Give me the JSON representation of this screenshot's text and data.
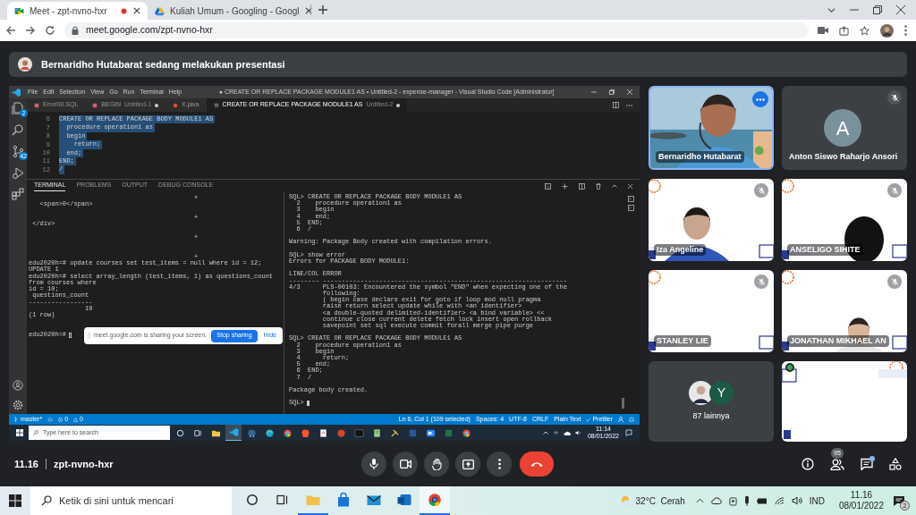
{
  "browser": {
    "tabs": [
      {
        "title": "Meet - zpt-nvno-hxr",
        "kind": "meet",
        "selected": true,
        "recording": true
      },
      {
        "title": "Kuliah Umum - Googling - Googl",
        "kind": "drive",
        "selected": false,
        "recording": false
      }
    ],
    "url": "meet.google.com/zpt-nvno-hxr"
  },
  "banner": {
    "text": "Bernaridho Hutabarat sedang melakukan presentasi"
  },
  "shared_screen": {
    "menu": [
      "File",
      "Edit",
      "Selection",
      "View",
      "Go",
      "Run",
      "Terminal",
      "Help"
    ],
    "title": "● CREATE OR REPLACE PACKAGE MODULE1 AS • Untitled-2 - expense-manager - Visual Studio Code [Administrator]",
    "activity_bar": [
      {
        "kind": "files",
        "badge": "2"
      },
      {
        "kind": "search"
      },
      {
        "kind": "source-control",
        "badge": "42"
      },
      {
        "kind": "run"
      },
      {
        "kind": "extensions"
      }
    ],
    "tabs": [
      {
        "label": "Error00.SQL",
        "kind": "sql",
        "modified": false,
        "selected": false
      },
      {
        "label": "BEGIN",
        "detail": "Untitled-1",
        "kind": "sql",
        "modified": true,
        "selected": false
      },
      {
        "label": "X.java",
        "kind": "java",
        "modified": false,
        "selected": false
      },
      {
        "label": "CREATE OR REPLACE PACKAGE MODULE1 AS",
        "detail": "Untitled-2",
        "kind": "text",
        "modified": true,
        "selected": true
      }
    ],
    "code": [
      {
        "number": "6",
        "text": "CREATE OR REPLACE PACKAGE BODY MODULE1 AS",
        "selected": true
      },
      {
        "number": "7",
        "text": "  procedure operation1 as",
        "selected": true
      },
      {
        "number": "8",
        "text": "  begin",
        "selected": true
      },
      {
        "number": "9",
        "text": "    return;",
        "selected": true
      },
      {
        "number": "10",
        "text": "  end;",
        "selected": true
      },
      {
        "number": "11",
        "text": "END;",
        "selected": true
      },
      {
        "number": "12",
        "text": "/",
        "selected": true
      }
    ],
    "panel_tabs": [
      {
        "label": "TERMINAL",
        "selected": true
      },
      {
        "label": "PROBLEMS",
        "selected": false
      },
      {
        "label": "OUTPUT",
        "selected": false
      },
      {
        "label": "DEBUG CONSOLE",
        "selected": false
      }
    ],
    "terminal_left": [
      {
        "kind": "wrap-mark",
        "text": "+"
      },
      {
        "kind": "text",
        "text": "   <span>0</span>"
      },
      {
        "kind": "gap"
      },
      {
        "kind": "wrap-mark",
        "text": "+"
      },
      {
        "kind": "text",
        "text": " </div>"
      },
      {
        "kind": "gap"
      },
      {
        "kind": "wrap-mark",
        "text": "+"
      },
      {
        "kind": "gap"
      },
      {
        "kind": "gap"
      },
      {
        "kind": "wrap-mark",
        "text": "+"
      },
      {
        "kind": "text",
        "text": "edu2020h=# update courses set test_items = null where id = 12;"
      },
      {
        "kind": "text",
        "text": "UPDATE 1"
      },
      {
        "kind": "text",
        "text": "edu2020h=# select array_length (test_items, 1) as questions_count from courses where"
      },
      {
        "kind": "text",
        "text": "id = 10;"
      },
      {
        "kind": "text",
        "text": " questions_count"
      },
      {
        "kind": "text",
        "text": "-----------------"
      },
      {
        "kind": "text",
        "text": "               10"
      },
      {
        "kind": "text",
        "text": "(1 row)"
      },
      {
        "kind": "gap"
      },
      {
        "kind": "gap"
      },
      {
        "kind": "prompt",
        "text": "edu2020h=#"
      }
    ],
    "terminal_right": [
      {
        "kind": "text",
        "text": "SQL> CREATE OR REPLACE PACKAGE BODY MODULE1 AS"
      },
      {
        "kind": "text",
        "text": "  2    procedure operation1 as"
      },
      {
        "kind": "text",
        "text": "  3    begin"
      },
      {
        "kind": "text",
        "text": "  4    end;"
      },
      {
        "kind": "text",
        "text": "  5  END;"
      },
      {
        "kind": "text",
        "text": "  6  /"
      },
      {
        "kind": "gap"
      },
      {
        "kind": "text",
        "text": "Warning: Package Body created with compilation errors."
      },
      {
        "kind": "gap"
      },
      {
        "kind": "text",
        "text": "SQL> show error"
      },
      {
        "kind": "text",
        "text": "Errors for PACKAGE BODY MODULE1:"
      },
      {
        "kind": "gap"
      },
      {
        "kind": "text",
        "text": "LINE/COL ERROR"
      },
      {
        "kind": "text",
        "text": "-------- -----------------------------------------------------------------"
      },
      {
        "kind": "text",
        "text": "4/3      PLS-00103: Encountered the symbol \"END\" when expecting one of the"
      },
      {
        "kind": "text",
        "text": "         following:"
      },
      {
        "kind": "text",
        "text": "         ( begin case declare exit for goto if loop mod null pragma"
      },
      {
        "kind": "text",
        "text": "         raise return select update while with <an identifier>"
      },
      {
        "kind": "text",
        "text": "         <a double-quoted delimited-identifier> <a bind variable> <<"
      },
      {
        "kind": "text",
        "text": "         continue close current delete fetch lock insert open rollback"
      },
      {
        "kind": "text",
        "text": "         savepoint set sql execute commit forall merge pipe purge"
      },
      {
        "kind": "gap"
      },
      {
        "kind": "text",
        "text": "SQL> CREATE OR REPLACE PACKAGE BODY MODULE1 AS"
      },
      {
        "kind": "text",
        "text": "  2    procedure operation1 as"
      },
      {
        "kind": "text",
        "text": "  3    begin"
      },
      {
        "kind": "text",
        "text": "  4      return;"
      },
      {
        "kind": "text",
        "text": "  5    end;"
      },
      {
        "kind": "text",
        "text": "  6  END;"
      },
      {
        "kind": "text",
        "text": "  7  /"
      },
      {
        "kind": "gap"
      },
      {
        "kind": "text",
        "text": "Package body created."
      },
      {
        "kind": "gap"
      },
      {
        "kind": "prompt",
        "text": "SQL>"
      }
    ],
    "share_notice": {
      "text": "meet.google.com is sharing your screen.",
      "stop": "Stop sharing",
      "hide": "Hide"
    },
    "status_bar": {
      "branch": "master*",
      "errors": "0",
      "warnings": "0",
      "items": [
        "Ln 6, Col 1 (109 selected)",
        "Spaces: 4",
        "UTF-8",
        "CRLF",
        "Plain Text",
        "Prettier"
      ]
    },
    "taskbar": {
      "search_placeholder": "Type here to search",
      "apps": [
        {
          "kind": "cortana",
          "selected": false
        },
        {
          "kind": "task-view",
          "selected": false
        },
        {
          "kind": "folder",
          "selected": false
        },
        {
          "kind": "vscode",
          "selected": true
        },
        {
          "kind": "database",
          "selected": false
        },
        {
          "kind": "edge",
          "selected": false
        },
        {
          "kind": "chrome",
          "selected": false
        },
        {
          "kind": "brave",
          "selected": false
        },
        {
          "kind": "pdf",
          "selected": false
        },
        {
          "kind": "powerpoint",
          "selected": false
        },
        {
          "kind": "terminal",
          "selected": false
        },
        {
          "kind": "notepad",
          "selected": false
        },
        {
          "kind": "tools",
          "selected": false
        },
        {
          "kind": "word",
          "selected": false
        },
        {
          "kind": "zoom",
          "selected": false
        },
        {
          "kind": "excel",
          "selected": false
        },
        {
          "kind": "chrome",
          "selected": false
        }
      ],
      "time": "11:14",
      "date": "08/01/2022"
    }
  },
  "participants": [
    {
      "kind": "camera",
      "name": "Bernaridho Hutabarat",
      "muted": false,
      "active": true
    },
    {
      "kind": "avatar",
      "name": "Anton Siswo Raharjo Ansori",
      "initial": "A",
      "muted": true,
      "active": false
    },
    {
      "kind": "camera",
      "name": "Iza Angeline",
      "muted": true,
      "active": false
    },
    {
      "kind": "camera",
      "name": "ANSELIGO SIHITE",
      "muted": true,
      "active": false
    },
    {
      "kind": "camera",
      "name": "STANLEY LIE",
      "muted": true,
      "active": false
    },
    {
      "kind": "camera",
      "name": "JONATHAN MIKHAEL AN",
      "muted": true,
      "active": false
    },
    {
      "kind": "others",
      "label": "87 lainnya",
      "initial": "Y"
    },
    {
      "kind": "picture"
    }
  ],
  "meeting_bar": {
    "time": "11.16",
    "code": "zpt-nvno-hxr",
    "people_count": "95",
    "chat_unread": true
  },
  "windows_taskbar": {
    "search_placeholder": "Ketik di sini untuk mencari",
    "apps": [
      {
        "kind": "cortana",
        "open": false,
        "selected": false
      },
      {
        "kind": "task-view",
        "open": false,
        "selected": false
      },
      {
        "kind": "folder",
        "open": true,
        "selected": false
      },
      {
        "kind": "store",
        "open": false,
        "selected": false
      },
      {
        "kind": "mail",
        "open": false,
        "selected": false
      },
      {
        "kind": "outlook",
        "open": false,
        "selected": false
      },
      {
        "kind": "chrome",
        "open": true,
        "selected": true
      }
    ],
    "weather": "32°C  Cerah",
    "language": "IND",
    "time": "11.16",
    "date": "08/01/2022",
    "notifications": "2"
  }
}
